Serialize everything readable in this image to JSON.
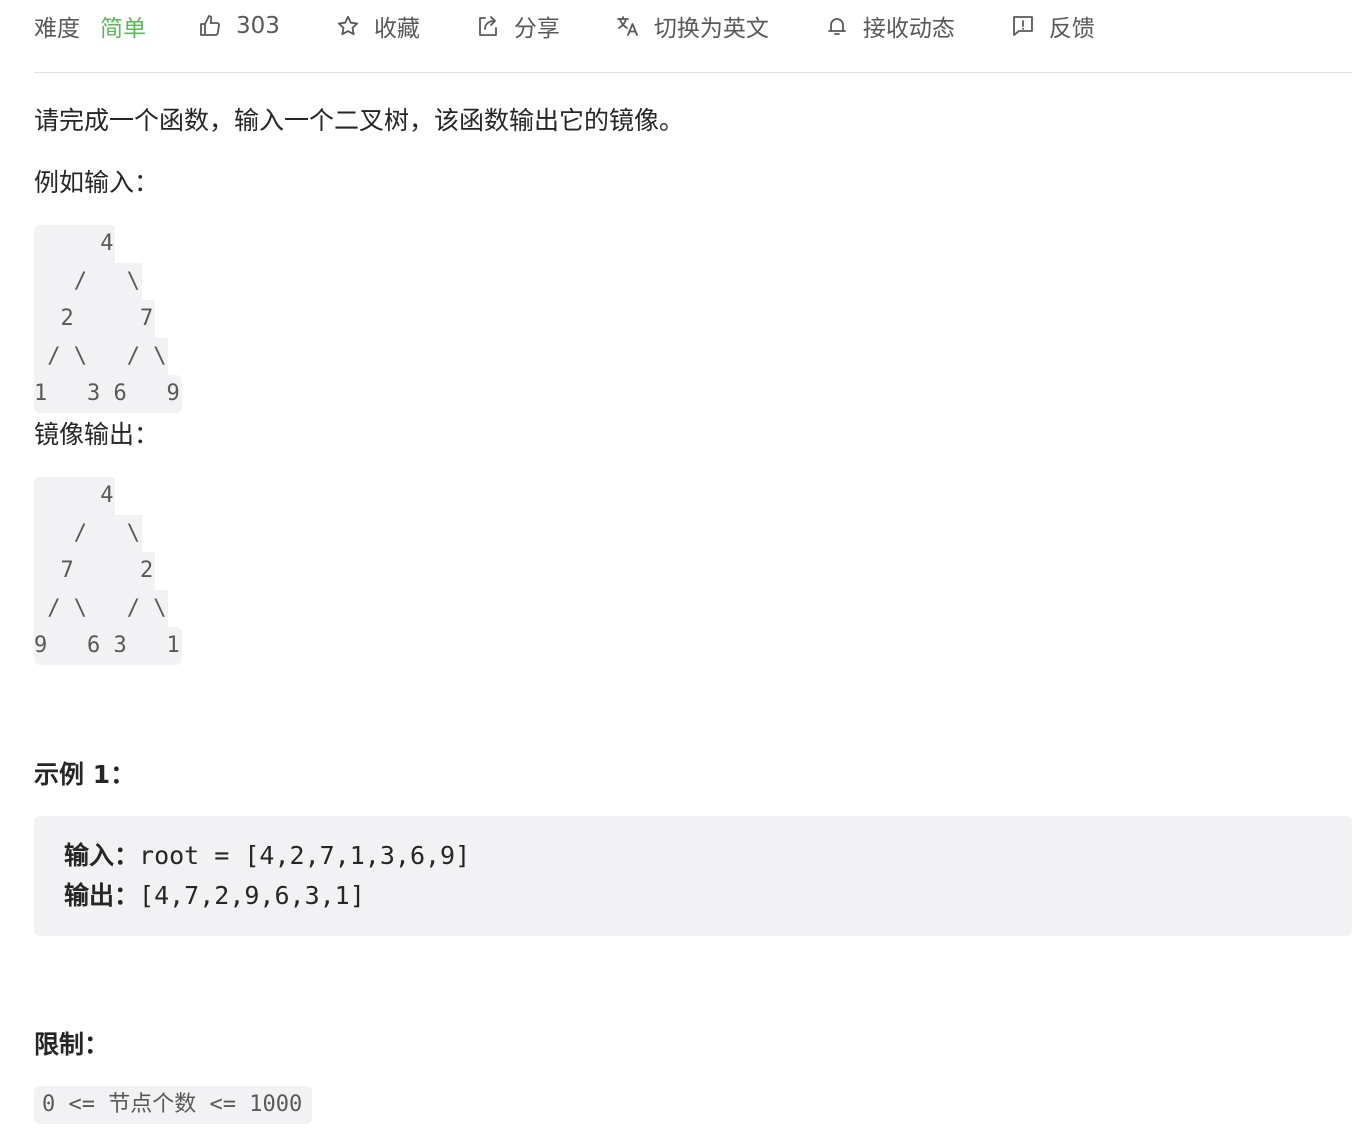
{
  "toolbar": {
    "difficulty_label": "难度",
    "difficulty_value": "简单",
    "difficulty_color": "#5cb85c",
    "likes": "303",
    "favorite": "收藏",
    "share": "分享",
    "switch_language": "切换为英文",
    "subscribe": "接收动态",
    "feedback": "反馈"
  },
  "description": {
    "intro": "请完成一个函数，输入一个二叉树，该函数输出它的镜像。",
    "input_label": "例如输入：",
    "input_tree": [
      "     4",
      "   /   \\",
      "  2     7",
      " / \\   / \\",
      "1   3 6   9"
    ],
    "output_label": "镜像输出：",
    "output_tree": [
      "     4",
      "   /   \\",
      "  7     2",
      " / \\   / \\",
      "9   6 3   1"
    ]
  },
  "example": {
    "title": "示例 1：",
    "input_label": "输入：",
    "input_value": "root = [4,2,7,1,3,6,9]",
    "output_label": "输出：",
    "output_value": "[4,7,2,9,6,3,1]"
  },
  "limits": {
    "title": "限制：",
    "constraint": "0 <= 节点个数 <= 1000"
  }
}
